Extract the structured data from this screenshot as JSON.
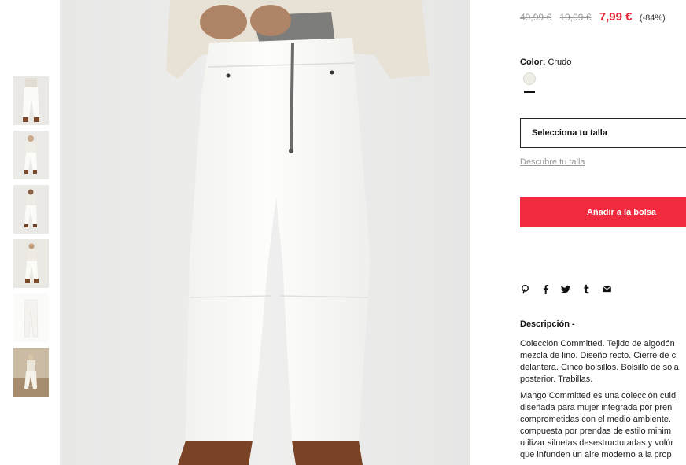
{
  "thumbnails": [
    {
      "name": "thumb-1"
    },
    {
      "name": "thumb-2"
    },
    {
      "name": "thumb-3"
    },
    {
      "name": "thumb-4"
    },
    {
      "name": "thumb-5"
    },
    {
      "name": "thumb-6"
    }
  ],
  "product": {
    "price_original": "49,99 €",
    "price_previous": "19,99 €",
    "price_current": "7,99 €",
    "discount": "(-84%)",
    "color_label": "Color:",
    "color_value": "Crudo",
    "swatch_color": "#efeee6",
    "size_select": "Selecciona tu talla",
    "size_guide_link": "Descubre tu talla",
    "add_to_bag": "Añadir a la bolsa"
  },
  "share": {
    "icons": [
      "pinterest-icon",
      "facebook-icon",
      "twitter-icon",
      "tumblr-icon",
      "email-icon"
    ]
  },
  "description": {
    "title": "Descripción  -",
    "lines_p1": [
      "Colección Committed. Tejido de algodón",
      "mezcla de lino. Diseño recto. Cierre de c",
      "delantera. Cinco bolsillos. Bolsillo de sola",
      "posterior. Trabillas."
    ],
    "lines_p2": [
      "Mango Committed es una colección cuid",
      "diseñada para mujer integrada por pren",
      "comprometidas con el medio ambiente.",
      "compuesta por prendas de estilo minim",
      "utilizar siluetas desestructuradas y volúr",
      "que infunden un aire moderno a la prop"
    ]
  },
  "colors": {
    "accent_red": "#e4223a",
    "button_red": "#f12a3e"
  }
}
